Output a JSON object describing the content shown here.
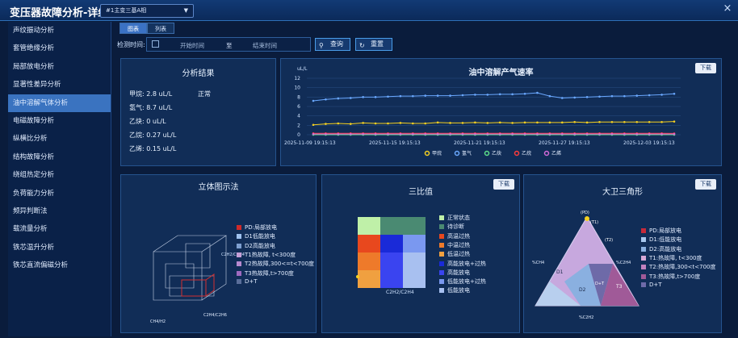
{
  "header": {
    "title": "变压器故障分析-详细",
    "device": "#1主变三基A相",
    "close": "×"
  },
  "sidebar": {
    "items": [
      "声纹振动分析",
      "套管绝缘分析",
      "局部放电分析",
      "显著性差异分析",
      "油中溶解气体分析",
      "电磁故障分析",
      "纵横比分析",
      "结构故障分析",
      "绕组热定分析",
      "负荷能力分析",
      "频异判断法",
      "载流量分析",
      "铁芯温升分析",
      "铁芯直流偏磁分析"
    ],
    "active": 4
  },
  "tabs": [
    "图表",
    "列表"
  ],
  "filter": {
    "label": "检测时间:",
    "start": "开始时间",
    "to": "至",
    "end": "结束时间",
    "query": "查询",
    "reset": "重置"
  },
  "result": {
    "title": "分析结果",
    "status": "正常",
    "rows": [
      {
        "label": "甲烷:",
        "value": "2.8 uL/L"
      },
      {
        "label": "氢气:",
        "value": "8.7 uL/L"
      },
      {
        "label": "乙炔:",
        "value": "0 uL/L"
      },
      {
        "label": "乙烷:",
        "value": "0.27 uL/L"
      },
      {
        "label": "乙烯:",
        "value": "0.15 uL/L"
      }
    ]
  },
  "download": "下载",
  "chart_data": [
    {
      "type": "line",
      "title": "油中溶解产气速率",
      "ylabel": "uL/L",
      "ylim": [
        0,
        12
      ],
      "yticks": [
        0,
        2,
        4,
        6,
        8,
        10,
        12
      ],
      "xticks": [
        "2025-11-09 19:15:13",
        "2025-11-15 19:15:13",
        "2025-11-21 19:15:13",
        "2025-11-27 19:15:13",
        "2025-12-03 19:15:13"
      ],
      "legend_position": "bottom",
      "series": [
        {
          "name": "甲烷",
          "color": "#f5d020",
          "values": [
            2.1,
            2.3,
            2.4,
            2.3,
            2.5,
            2.4,
            2.4,
            2.5,
            2.4,
            2.4,
            2.6,
            2.5,
            2.5,
            2.6,
            2.5,
            2.6,
            2.5,
            2.6,
            2.6,
            2.6,
            2.6,
            2.7,
            2.6,
            2.7,
            2.7,
            2.7,
            2.7,
            2.7,
            2.7,
            2.8
          ]
        },
        {
          "name": "氢气",
          "color": "#6aa8ff",
          "values": [
            7.2,
            7.5,
            7.7,
            7.8,
            8.0,
            8.0,
            8.1,
            8.2,
            8.2,
            8.3,
            8.3,
            8.3,
            8.4,
            8.5,
            8.5,
            8.6,
            8.6,
            8.7,
            8.9,
            8.2,
            7.8,
            7.9,
            8.0,
            8.1,
            8.2,
            8.2,
            8.3,
            8.4,
            8.5,
            8.7
          ]
        },
        {
          "name": "乙炔",
          "color": "#5ce08a",
          "values": [
            0,
            0,
            0,
            0,
            0,
            0,
            0,
            0,
            0,
            0,
            0,
            0,
            0,
            0,
            0,
            0,
            0,
            0,
            0,
            0,
            0,
            0,
            0,
            0,
            0,
            0,
            0,
            0,
            0,
            0
          ]
        },
        {
          "name": "乙烷",
          "color": "#ff3b3b",
          "values": [
            0.3,
            0.3,
            0.3,
            0.3,
            0.3,
            0.3,
            0.3,
            0.3,
            0.3,
            0.3,
            0.3,
            0.3,
            0.3,
            0.3,
            0.3,
            0.3,
            0.3,
            0.3,
            0.3,
            0.3,
            0.3,
            0.3,
            0.3,
            0.3,
            0.3,
            0.3,
            0.3,
            0.3,
            0.3,
            0.27
          ]
        },
        {
          "name": "乙烯",
          "color": "#d26ad8",
          "values": [
            0.15,
            0.15,
            0.15,
            0.15,
            0.15,
            0.15,
            0.15,
            0.15,
            0.15,
            0.15,
            0.15,
            0.15,
            0.15,
            0.15,
            0.15,
            0.15,
            0.15,
            0.15,
            0.15,
            0.15,
            0.15,
            0.15,
            0.15,
            0.15,
            0.15,
            0.15,
            0.15,
            0.15,
            0.15,
            0.15
          ]
        }
      ]
    },
    {
      "type": "scatter",
      "title": "立体图示法",
      "xlabel": "CH4/H2",
      "ylabel": "C2H4/C2H6",
      "zlabel": "C2H2/C2H4",
      "legend": [
        {
          "name": "PD:局部放电",
          "color": "#d02a2a"
        },
        {
          "name": "D1低能放电",
          "color": "#9fc2ef"
        },
        {
          "name": "D2高能放电",
          "color": "#7e9fd0"
        },
        {
          "name": "T1热故障, t<300度",
          "color": "#c6a0d8"
        },
        {
          "name": "T2热故障,300<=t<700度",
          "color": "#b78ad0"
        },
        {
          "name": "T3热故障,t>700度",
          "color": "#9f6ac0"
        },
        {
          "name": "D+T",
          "color": "#5a6e9a"
        }
      ]
    },
    {
      "type": "heatmap",
      "title": "三比值",
      "xlabel": "C2H2/C2H4",
      "legend": [
        {
          "name": "正常状态",
          "color": "#bff0a8"
        },
        {
          "name": "待诊断",
          "color": "#4a8a72"
        },
        {
          "name": "高温过热",
          "color": "#e8481e"
        },
        {
          "name": "中温过热",
          "color": "#ee7a2a"
        },
        {
          "name": "低温过热",
          "color": "#f0a040"
        },
        {
          "name": "高能放电+过热",
          "color": "#1a2ad8"
        },
        {
          "name": "高能放电",
          "color": "#3a44f0"
        },
        {
          "name": "低能放电+过热",
          "color": "#7a98f0"
        },
        {
          "name": "低能放电",
          "color": "#a8c0f0"
        }
      ]
    },
    {
      "type": "diagram",
      "title": "大卫三角形",
      "corner_labels": [
        "(PD)",
        "(T1)",
        "(T2)",
        "D1",
        "D2",
        "T3",
        "D+T"
      ],
      "axes": [
        "%CH4",
        "%C2H4",
        "%C2H2"
      ],
      "legend": [
        {
          "name": "PD:局部放电",
          "color": "#c62a3a"
        },
        {
          "name": "D1:低能放电",
          "color": "#a8c8ee"
        },
        {
          "name": "D2:高能放电",
          "color": "#8ab0e0"
        },
        {
          "name": "T1:热故障, t<300度",
          "color": "#d6a8d6"
        },
        {
          "name": "T2:热故障,300<t<700度",
          "color": "#c282c0"
        },
        {
          "name": "T3:热故障,t>700度",
          "color": "#a05a98"
        },
        {
          "name": "D+T",
          "color": "#6e6aa8"
        }
      ]
    }
  ]
}
